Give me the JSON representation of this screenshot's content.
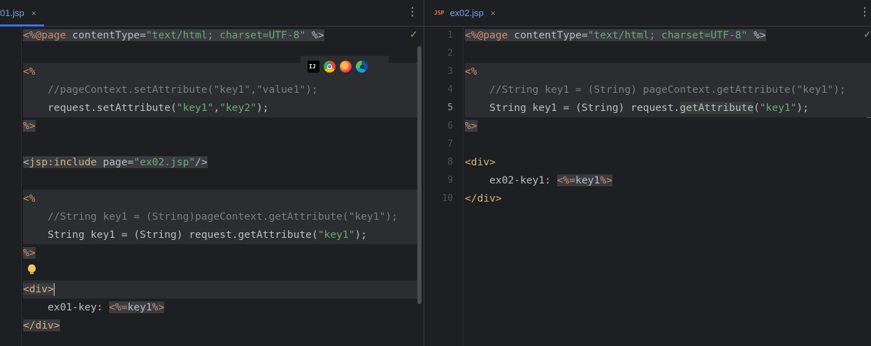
{
  "left_editor": {
    "tab": {
      "title": "01.jsp",
      "close": "×"
    },
    "more": "⋮",
    "check": "✓",
    "lines": [
      [
        [
          "tok-delim tagbg",
          "<%@"
        ],
        [
          "tok-kw tagbg",
          "page"
        ],
        [
          "tok-attr tagbg",
          " contentType="
        ],
        [
          "tok-str tagbg",
          "\"text/html; charset=UTF-8\""
        ],
        [
          "tok-attr tagbg",
          " %>"
        ]
      ],
      [],
      [
        [
          "tok-delim",
          "<%"
        ]
      ],
      [
        [
          "tok-cmt",
          "    //pageContext.setAttribute(\"key1\",\"value1\");"
        ]
      ],
      [
        [
          "tok-attr",
          "    request.setAttribute("
        ],
        [
          "tok-str",
          "\"key1\""
        ],
        [
          "tok-attr",
          ","
        ],
        [
          "tok-str",
          "\"key2\""
        ],
        [
          "tok-attr",
          ");"
        ]
      ],
      [
        [
          "tok-delim tagbg",
          "%>"
        ]
      ],
      [],
      [
        [
          "tok-attr tagbg",
          "<"
        ],
        [
          "tok-ns tagbg",
          "jsp:include"
        ],
        [
          "tok-attr tagbg",
          " page="
        ],
        [
          "tok-str tagbg",
          "\"ex02.jsp\""
        ],
        [
          "tok-attr tagbg",
          "/>"
        ]
      ],
      [],
      [
        [
          "tok-delim",
          "<%"
        ]
      ],
      [
        [
          "tok-cmt",
          "    //String key1 = (String)pageContext.getAttribute(\"key1\");"
        ]
      ],
      [
        [
          "tok-attr",
          "    String key1 = (String) request.getAttribute("
        ],
        [
          "tok-str",
          "\"key1\""
        ],
        [
          "tok-attr",
          ");"
        ]
      ],
      [
        [
          "tok-delim tagbg",
          "%>"
        ]
      ],
      [],
      [
        [
          "tok-tag tagbg",
          "<div>"
        ]
      ],
      [
        [
          "tok-attr",
          "    ex01-key: "
        ],
        [
          "tok-delim tagbg",
          "<%="
        ],
        [
          "tok-attr tagbg",
          "key1"
        ],
        [
          "tok-delim tagbg",
          "%>"
        ]
      ],
      [
        [
          "tok-tag tagbg",
          "</div>"
        ]
      ]
    ]
  },
  "right_editor": {
    "tab": {
      "badge": "JSP",
      "title": "ex02.jsp",
      "close": "×"
    },
    "more": "⋮",
    "check": "✓",
    "line_numbers": [
      "1",
      "2",
      "3",
      "4",
      "5",
      "6",
      "7",
      "8",
      "9",
      "10"
    ],
    "current_line": "5",
    "lines": [
      [
        [
          "tok-delim tagbg",
          "<%@"
        ],
        [
          "tok-kw tagbg",
          "page"
        ],
        [
          "tok-attr tagbg",
          " contentType="
        ],
        [
          "tok-str tagbg",
          "\"text/html; charset=UTF-8\""
        ],
        [
          "tok-attr tagbg",
          " %>"
        ]
      ],
      [],
      [
        [
          "tok-delim",
          "<%"
        ]
      ],
      [
        [
          "tok-cmt",
          "    //String key1 = (String) pageContext.getAttribute(\"key1\");"
        ]
      ],
      [
        [
          "tok-attr",
          "    String key1 = (String) request."
        ],
        [
          "tok-attr tok-method",
          "getAttribute"
        ],
        [
          "tok-attr",
          "("
        ],
        [
          "tok-str",
          "\"key1\""
        ],
        [
          "tok-attr",
          ");"
        ]
      ],
      [
        [
          "tok-delim tagbg",
          "%>"
        ]
      ],
      [],
      [
        [
          "tok-tag",
          "<div>"
        ]
      ],
      [
        [
          "tok-attr",
          "    ex02-key1: "
        ],
        [
          "tok-delim tagbg",
          "<%="
        ],
        [
          "tok-attr tagbg",
          "key1"
        ],
        [
          "tok-delim tagbg",
          "%>"
        ]
      ],
      [
        [
          "tok-tag",
          "</div>"
        ]
      ]
    ]
  },
  "browser_icons": [
    {
      "name": "intellij-icon",
      "label": "IJ"
    },
    {
      "name": "chrome-icon"
    },
    {
      "name": "firefox-icon"
    },
    {
      "name": "edge-icon"
    }
  ]
}
